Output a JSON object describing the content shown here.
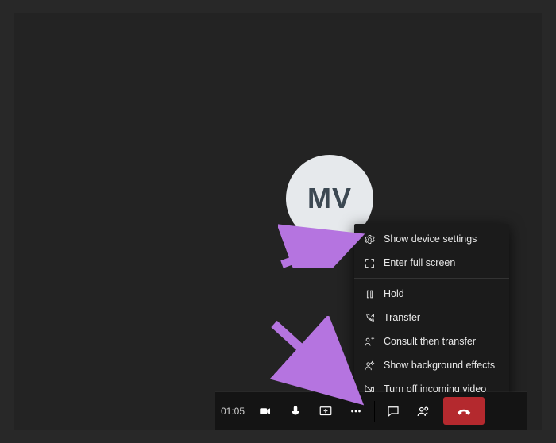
{
  "avatar": {
    "initials": "MV"
  },
  "call": {
    "duration": "01:05"
  },
  "menu": {
    "items": [
      {
        "label": "Show device settings",
        "id": "device-settings"
      },
      {
        "label": "Enter full screen",
        "id": "full-screen"
      },
      {
        "label": "Hold",
        "id": "hold"
      },
      {
        "label": "Transfer",
        "id": "transfer"
      },
      {
        "label": "Consult then transfer",
        "id": "consult-transfer"
      },
      {
        "label": "Show background effects",
        "id": "background-effects"
      },
      {
        "label": "Turn off incoming video",
        "id": "incoming-video"
      }
    ]
  },
  "toolbar": {
    "camera": "camera",
    "mic": "mic",
    "share": "share",
    "more": "more-actions",
    "chat": "chat",
    "people": "people",
    "hangup": "hang-up"
  }
}
